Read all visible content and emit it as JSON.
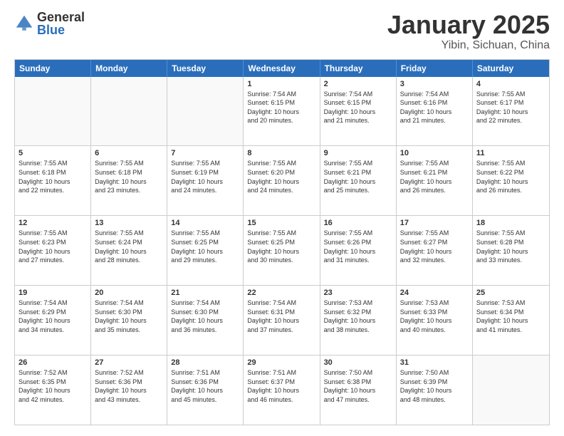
{
  "header": {
    "logo_general": "General",
    "logo_blue": "Blue",
    "month_title": "January 2025",
    "location": "Yibin, Sichuan, China"
  },
  "calendar": {
    "days": [
      "Sunday",
      "Monday",
      "Tuesday",
      "Wednesday",
      "Thursday",
      "Friday",
      "Saturday"
    ],
    "rows": [
      [
        {
          "day": "",
          "info": "",
          "empty": true
        },
        {
          "day": "",
          "info": "",
          "empty": true
        },
        {
          "day": "",
          "info": "",
          "empty": true
        },
        {
          "day": "1",
          "info": "Sunrise: 7:54 AM\nSunset: 6:15 PM\nDaylight: 10 hours\nand 20 minutes.",
          "empty": false
        },
        {
          "day": "2",
          "info": "Sunrise: 7:54 AM\nSunset: 6:15 PM\nDaylight: 10 hours\nand 21 minutes.",
          "empty": false
        },
        {
          "day": "3",
          "info": "Sunrise: 7:54 AM\nSunset: 6:16 PM\nDaylight: 10 hours\nand 21 minutes.",
          "empty": false
        },
        {
          "day": "4",
          "info": "Sunrise: 7:55 AM\nSunset: 6:17 PM\nDaylight: 10 hours\nand 22 minutes.",
          "empty": false
        }
      ],
      [
        {
          "day": "5",
          "info": "Sunrise: 7:55 AM\nSunset: 6:18 PM\nDaylight: 10 hours\nand 22 minutes.",
          "empty": false
        },
        {
          "day": "6",
          "info": "Sunrise: 7:55 AM\nSunset: 6:18 PM\nDaylight: 10 hours\nand 23 minutes.",
          "empty": false
        },
        {
          "day": "7",
          "info": "Sunrise: 7:55 AM\nSunset: 6:19 PM\nDaylight: 10 hours\nand 24 minutes.",
          "empty": false
        },
        {
          "day": "8",
          "info": "Sunrise: 7:55 AM\nSunset: 6:20 PM\nDaylight: 10 hours\nand 24 minutes.",
          "empty": false
        },
        {
          "day": "9",
          "info": "Sunrise: 7:55 AM\nSunset: 6:21 PM\nDaylight: 10 hours\nand 25 minutes.",
          "empty": false
        },
        {
          "day": "10",
          "info": "Sunrise: 7:55 AM\nSunset: 6:21 PM\nDaylight: 10 hours\nand 26 minutes.",
          "empty": false
        },
        {
          "day": "11",
          "info": "Sunrise: 7:55 AM\nSunset: 6:22 PM\nDaylight: 10 hours\nand 26 minutes.",
          "empty": false
        }
      ],
      [
        {
          "day": "12",
          "info": "Sunrise: 7:55 AM\nSunset: 6:23 PM\nDaylight: 10 hours\nand 27 minutes.",
          "empty": false
        },
        {
          "day": "13",
          "info": "Sunrise: 7:55 AM\nSunset: 6:24 PM\nDaylight: 10 hours\nand 28 minutes.",
          "empty": false
        },
        {
          "day": "14",
          "info": "Sunrise: 7:55 AM\nSunset: 6:25 PM\nDaylight: 10 hours\nand 29 minutes.",
          "empty": false
        },
        {
          "day": "15",
          "info": "Sunrise: 7:55 AM\nSunset: 6:25 PM\nDaylight: 10 hours\nand 30 minutes.",
          "empty": false
        },
        {
          "day": "16",
          "info": "Sunrise: 7:55 AM\nSunset: 6:26 PM\nDaylight: 10 hours\nand 31 minutes.",
          "empty": false
        },
        {
          "day": "17",
          "info": "Sunrise: 7:55 AM\nSunset: 6:27 PM\nDaylight: 10 hours\nand 32 minutes.",
          "empty": false
        },
        {
          "day": "18",
          "info": "Sunrise: 7:55 AM\nSunset: 6:28 PM\nDaylight: 10 hours\nand 33 minutes.",
          "empty": false
        }
      ],
      [
        {
          "day": "19",
          "info": "Sunrise: 7:54 AM\nSunset: 6:29 PM\nDaylight: 10 hours\nand 34 minutes.",
          "empty": false
        },
        {
          "day": "20",
          "info": "Sunrise: 7:54 AM\nSunset: 6:30 PM\nDaylight: 10 hours\nand 35 minutes.",
          "empty": false
        },
        {
          "day": "21",
          "info": "Sunrise: 7:54 AM\nSunset: 6:30 PM\nDaylight: 10 hours\nand 36 minutes.",
          "empty": false
        },
        {
          "day": "22",
          "info": "Sunrise: 7:54 AM\nSunset: 6:31 PM\nDaylight: 10 hours\nand 37 minutes.",
          "empty": false
        },
        {
          "day": "23",
          "info": "Sunrise: 7:53 AM\nSunset: 6:32 PM\nDaylight: 10 hours\nand 38 minutes.",
          "empty": false
        },
        {
          "day": "24",
          "info": "Sunrise: 7:53 AM\nSunset: 6:33 PM\nDaylight: 10 hours\nand 40 minutes.",
          "empty": false
        },
        {
          "day": "25",
          "info": "Sunrise: 7:53 AM\nSunset: 6:34 PM\nDaylight: 10 hours\nand 41 minutes.",
          "empty": false
        }
      ],
      [
        {
          "day": "26",
          "info": "Sunrise: 7:52 AM\nSunset: 6:35 PM\nDaylight: 10 hours\nand 42 minutes.",
          "empty": false
        },
        {
          "day": "27",
          "info": "Sunrise: 7:52 AM\nSunset: 6:36 PM\nDaylight: 10 hours\nand 43 minutes.",
          "empty": false
        },
        {
          "day": "28",
          "info": "Sunrise: 7:51 AM\nSunset: 6:36 PM\nDaylight: 10 hours\nand 45 minutes.",
          "empty": false
        },
        {
          "day": "29",
          "info": "Sunrise: 7:51 AM\nSunset: 6:37 PM\nDaylight: 10 hours\nand 46 minutes.",
          "empty": false
        },
        {
          "day": "30",
          "info": "Sunrise: 7:50 AM\nSunset: 6:38 PM\nDaylight: 10 hours\nand 47 minutes.",
          "empty": false
        },
        {
          "day": "31",
          "info": "Sunrise: 7:50 AM\nSunset: 6:39 PM\nDaylight: 10 hours\nand 48 minutes.",
          "empty": false
        },
        {
          "day": "",
          "info": "",
          "empty": true
        }
      ]
    ]
  }
}
